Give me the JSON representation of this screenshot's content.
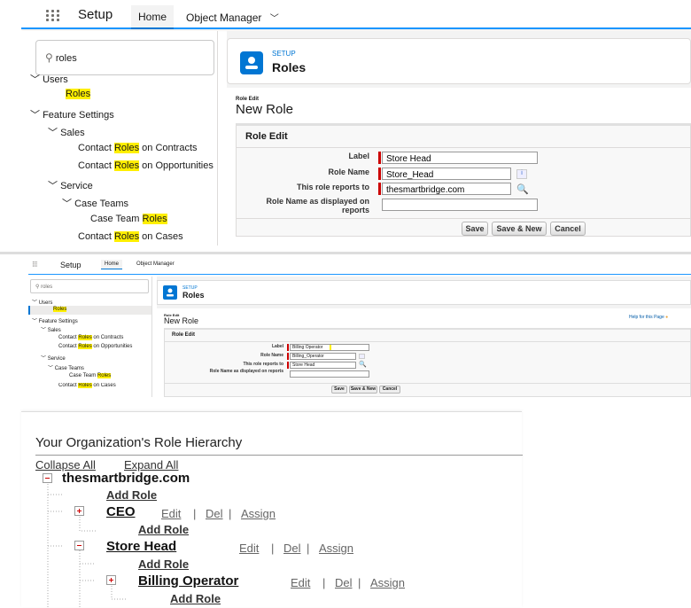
{
  "app": {
    "title": "Setup",
    "tab_home": "Home",
    "tab_object_manager": "Object Manager"
  },
  "search": {
    "value": "roles"
  },
  "tree": {
    "users": "Users",
    "roles": "Roles",
    "feature_settings": "Feature Settings",
    "sales": "Sales",
    "contact_prefix": "Contact ",
    "roles_word": "Roles",
    "on_contracts": " on Contracts",
    "on_opportunities": " on Opportunities",
    "service": "Service",
    "case_teams": "Case Teams",
    "case_team_prefix": "Case Team ",
    "on_cases": " on Cases"
  },
  "header": {
    "eyebrow": "SETUP",
    "title": "Roles"
  },
  "form1": {
    "crumb": "Role Edit",
    "heading": "New Role",
    "section": "Role Edit",
    "label_label": "Label",
    "label_value": "Store Head",
    "rolename_label": "Role Name",
    "rolename_value": "Store_Head",
    "reports_label": "This role reports to",
    "reports_value": "thesmartbridge.com",
    "display_label": "Role Name as displayed on reports",
    "display_value": "",
    "save": "Save",
    "save_new": "Save & New",
    "cancel": "Cancel"
  },
  "form2": {
    "help": "Help for this Page",
    "label_value": "Billing Operator",
    "rolename_value": "Billing_Operator",
    "reports_label": "This role reports to",
    "reports_value": "Store Head"
  },
  "hierarchy": {
    "title": "Your Organization's Role Hierarchy",
    "collapse_all": "Collapse All",
    "expand_all": "Expand All",
    "root": "thesmartbridge.com",
    "add_role": "Add Role",
    "ceo": "CEO",
    "store_head": "Store Head",
    "billing_operator": "Billing Operator",
    "edit": "Edit",
    "del": "Del",
    "assign": "Assign",
    "sep": "|"
  },
  "colors": {
    "brand_blue": "#0176d3",
    "highlight": "#ffef00",
    "required": "#cc0000"
  }
}
